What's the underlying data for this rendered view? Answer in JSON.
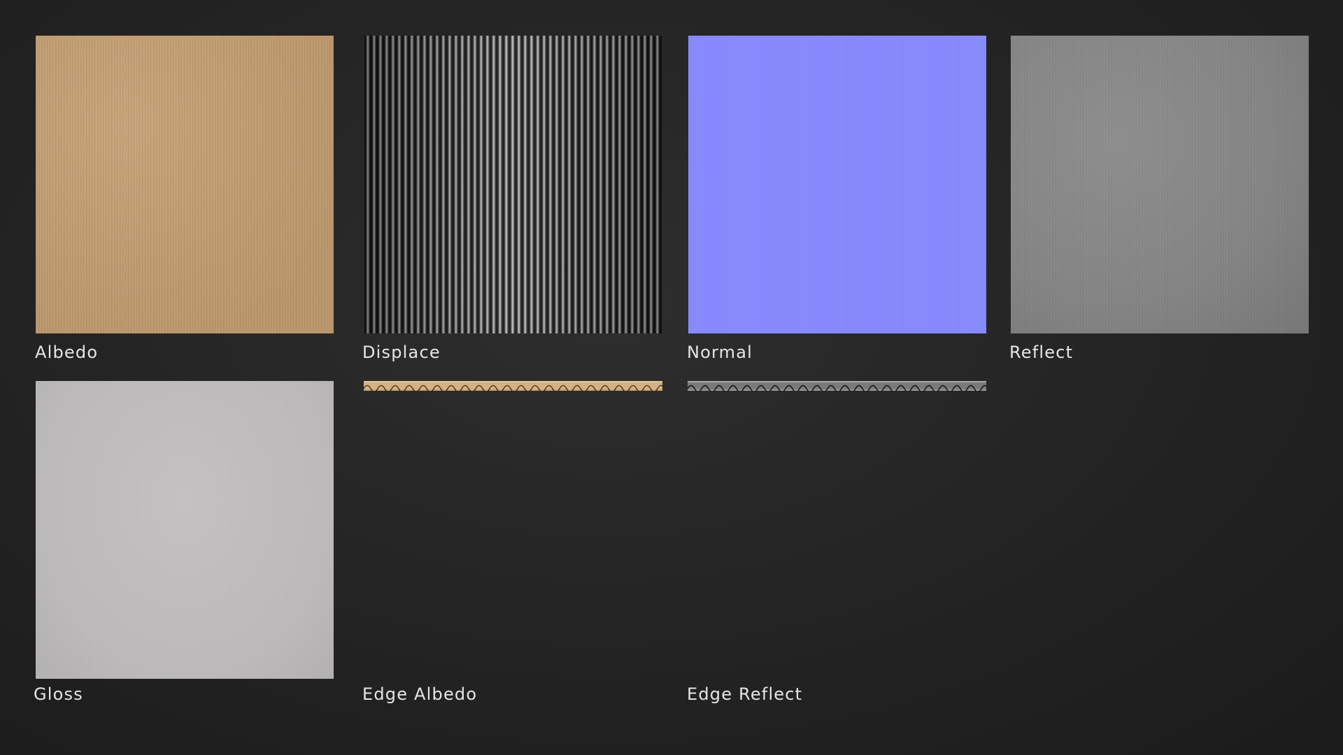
{
  "swatches": [
    {
      "id": "albedo",
      "label": "Albedo",
      "icon": "albedo-texture"
    },
    {
      "id": "displace",
      "label": "Displace",
      "icon": "displacement-texture"
    },
    {
      "id": "normal",
      "label": "Normal",
      "icon": "normal-map-texture"
    },
    {
      "id": "reflect",
      "label": "Reflect",
      "icon": "reflect-texture"
    },
    {
      "id": "gloss",
      "label": "Gloss",
      "icon": "gloss-texture"
    },
    {
      "id": "edge_albedo",
      "label": "Edge Albedo",
      "icon": "edge-albedo-strip"
    },
    {
      "id": "edge_reflect",
      "label": "Edge Reflect",
      "icon": "edge-reflect-strip"
    }
  ],
  "colors": {
    "background": "#252525",
    "label_text": "#e6e6e6",
    "albedo": "#c59f72",
    "normal": "#8a8cfb",
    "reflect": "#858585",
    "gloss": "#bcbaba",
    "edge_albedo": "#d9b98e",
    "edge_reflect": "#8a8a8a"
  }
}
